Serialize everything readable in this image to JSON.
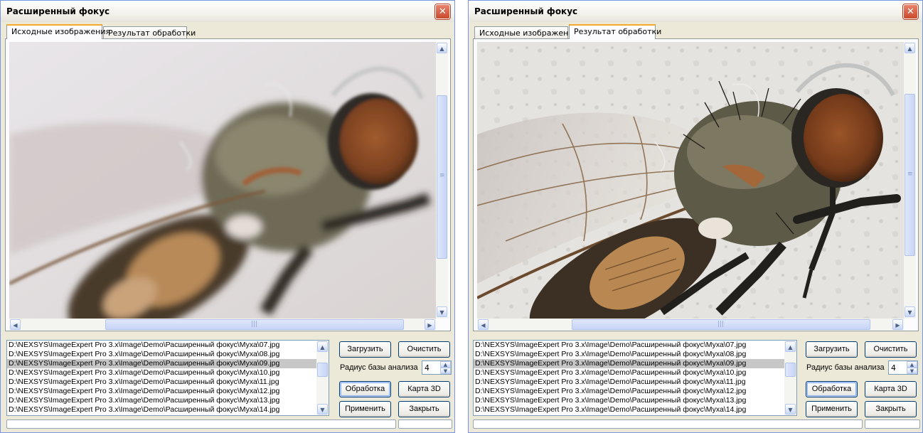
{
  "windows": [
    {
      "title": "Расширенный фокус",
      "tabs": [
        "Исходные изображения",
        "Результат обработки"
      ],
      "active_tab": 0,
      "image_state": "blurred source frame"
    },
    {
      "title": "Расширенный фокус",
      "tabs": [
        "Исходные изображения",
        "Результат обработки"
      ],
      "active_tab": 1,
      "image_state": "focus-stacked result"
    }
  ],
  "files": [
    "D:\\NEXSYS\\ImageExpert Pro 3.x\\Image\\Demo\\Расширенный фокус\\Муха\\07.jpg",
    "D:\\NEXSYS\\ImageExpert Pro 3.x\\Image\\Demo\\Расширенный фокус\\Муха\\08.jpg",
    "D:\\NEXSYS\\ImageExpert Pro 3.x\\Image\\Demo\\Расширенный фокус\\Муха\\09.jpg",
    "D:\\NEXSYS\\ImageExpert Pro 3.x\\Image\\Demo\\Расширенный фокус\\Муха\\10.jpg",
    "D:\\NEXSYS\\ImageExpert Pro 3.x\\Image\\Demo\\Расширенный фокус\\Муха\\11.jpg",
    "D:\\NEXSYS\\ImageExpert Pro 3.x\\Image\\Demo\\Расширенный фокус\\Муха\\12.jpg",
    "D:\\NEXSYS\\ImageExpert Pro 3.x\\Image\\Demo\\Расширенный фокус\\Муха\\13.jpg",
    "D:\\NEXSYS\\ImageExpert Pro 3.x\\Image\\Demo\\Расширенный фокус\\Муха\\14.jpg"
  ],
  "selected_file_index": 2,
  "buttons": {
    "load": "Загрузить",
    "clear": "Очистить",
    "process": "Обработка",
    "map3d": "Карта 3D",
    "apply": "Применить",
    "close": "Закрыть"
  },
  "radius": {
    "label": "Радиус базы анализа",
    "value": "4"
  },
  "icons": {
    "close": "close-x-icon",
    "scroll_up": "arrow-up-icon",
    "scroll_down": "arrow-down-icon",
    "scroll_left": "arrow-left-icon",
    "scroll_right": "arrow-right-icon",
    "grip": "grip-icon"
  },
  "colors": {
    "window_bg": "#ece9d8",
    "close_button": "#d0573a",
    "tab_highlight": "#f6a828",
    "selection": "#c7c7c7"
  }
}
